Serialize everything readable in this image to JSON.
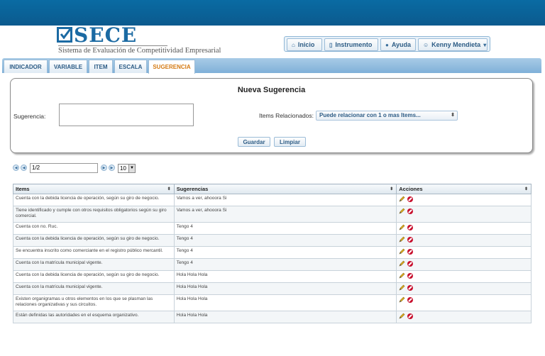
{
  "brand": {
    "name": "SECE",
    "subtitle": "Sistema de Evaluación de Competitividad Empresarial",
    "color": "#1b6aa3"
  },
  "topnav": [
    {
      "label": "Inicio",
      "icon": "home-icon"
    },
    {
      "label": "Instrumento",
      "icon": "document-icon"
    },
    {
      "label": "Ayuda",
      "icon": "info-icon"
    },
    {
      "label": "Kenny Mendieta",
      "icon": "user-icon",
      "dropdown": true
    }
  ],
  "tabs": [
    {
      "label": "INDICADOR"
    },
    {
      "label": "VARIABLE"
    },
    {
      "label": "ITEM"
    },
    {
      "label": "ESCALA"
    },
    {
      "label": "SUGERENCIA",
      "active": true
    }
  ],
  "form": {
    "title": "Nueva Sugerencia",
    "sugerencia_label": "Sugerencia:",
    "sugerencia_value": "",
    "items_label": "Items Relacionados:",
    "items_placeholder": "Puede relacionar con 1 o mas Items...",
    "save_label": "Guardar",
    "clear_label": "Limpiar"
  },
  "pager": {
    "page_value": "1/2",
    "page_size": "10"
  },
  "table": {
    "columns": [
      "Items",
      "Sugerencias",
      "Acciones"
    ],
    "rows": [
      {
        "item": "Cuenta con la debida licencia de operación, según su giro de negocio.",
        "sugerencia": "Vamos a ver, ahooora Si"
      },
      {
        "item": "Tiene identificado y cumple con otros requisitos obligatorios según su giro comercial.",
        "sugerencia": "Vamos a ver, ahooora Si"
      },
      {
        "item": "Cuenta con no. Ruc.",
        "sugerencia": "Tengo 4"
      },
      {
        "item": "Cuenta con la debida licencia de operación, según su giro de negocio.",
        "sugerencia": "Tengo 4"
      },
      {
        "item": "Se encuentra inscrito como comerciante en el registro público mercantil.",
        "sugerencia": "Tengo 4"
      },
      {
        "item": "Cuenta con la matrícula municipal vigente.",
        "sugerencia": "Tengo 4"
      },
      {
        "item": "Cuenta con la debida licencia de operación, según su giro de negocio.",
        "sugerencia": "Hola Hola Hola"
      },
      {
        "item": "Cuenta con la matrícula municipal vigente.",
        "sugerencia": "Hola Hola Hola"
      },
      {
        "item": "Existen organigramas u otros elementos en los que se plasman las relaciones organizativas y sus circuitos.",
        "sugerencia": "Hola Hola Hola"
      },
      {
        "item": "Están definidas las autoridades en el esquema organizativo.",
        "sugerencia": "Hola Hola Hola"
      }
    ]
  }
}
